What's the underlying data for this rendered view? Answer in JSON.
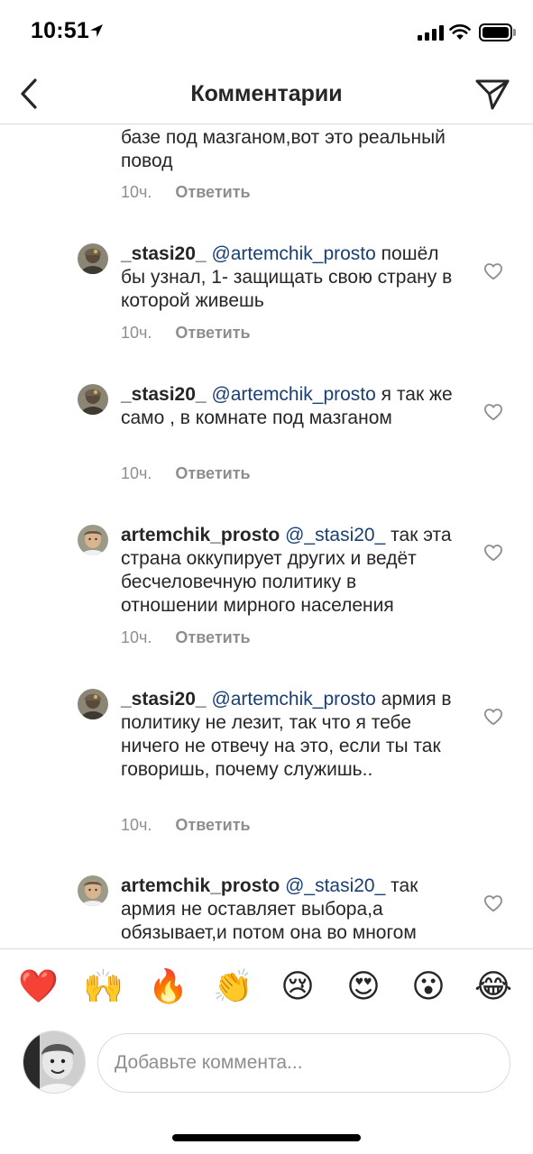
{
  "status_bar": {
    "time": "10:51"
  },
  "header": {
    "title": "Комментарии",
    "back_icon": "chevron-left-icon",
    "send_icon": "paper-plane-icon"
  },
  "comments": [
    {
      "id": "c0",
      "username": "",
      "mention": "",
      "text": "базе под мазганом,вот это реальный повод",
      "time": "10ч.",
      "reply_label": "Ответить"
    },
    {
      "id": "c1",
      "username": "_stasi20_",
      "mention": "@artemchik_prosto",
      "text": "пошёл бы узнал, 1- защищать свою страну в которой живешь",
      "time": "10ч.",
      "reply_label": "Ответить"
    },
    {
      "id": "c2",
      "username": "_stasi20_",
      "mention": "@artemchik_prosto",
      "text": "я так же само , в комнате под мазганом",
      "time": "10ч.",
      "reply_label": "Ответить"
    },
    {
      "id": "c3",
      "username": "artemchik_prosto",
      "mention": "@_stasi20_",
      "text": "так эта страна оккупирует других и ведёт бесчеловечную политику в отношении мирного населения",
      "time": "10ч.",
      "reply_label": "Ответить"
    },
    {
      "id": "c4",
      "username": "_stasi20_",
      "mention": "@artemchik_prosto",
      "text": "армия в политику не лезит, так что я тебе ничего не отвечу на это, если ты так говоришь, почему служишь..",
      "time": "10ч.",
      "reply_label": "Ответить"
    },
    {
      "id": "c5",
      "username": "artemchik_prosto",
      "mention": "@_stasi20_",
      "text": "так армия не оставляет выбора,а обязывает,и потом она во многом",
      "time": "",
      "reply_label": ""
    }
  ],
  "emoji_bar": [
    "❤️",
    "🙌",
    "🔥",
    "👏",
    "😢",
    "😍",
    "😮",
    "😂"
  ],
  "input": {
    "placeholder": "Добавьте коммента..."
  },
  "colors": {
    "text": "#262626",
    "secondary": "#8e8e8e",
    "mention": "#1b3f73",
    "divider": "#dbdbdb",
    "heart": "#ed4956"
  }
}
